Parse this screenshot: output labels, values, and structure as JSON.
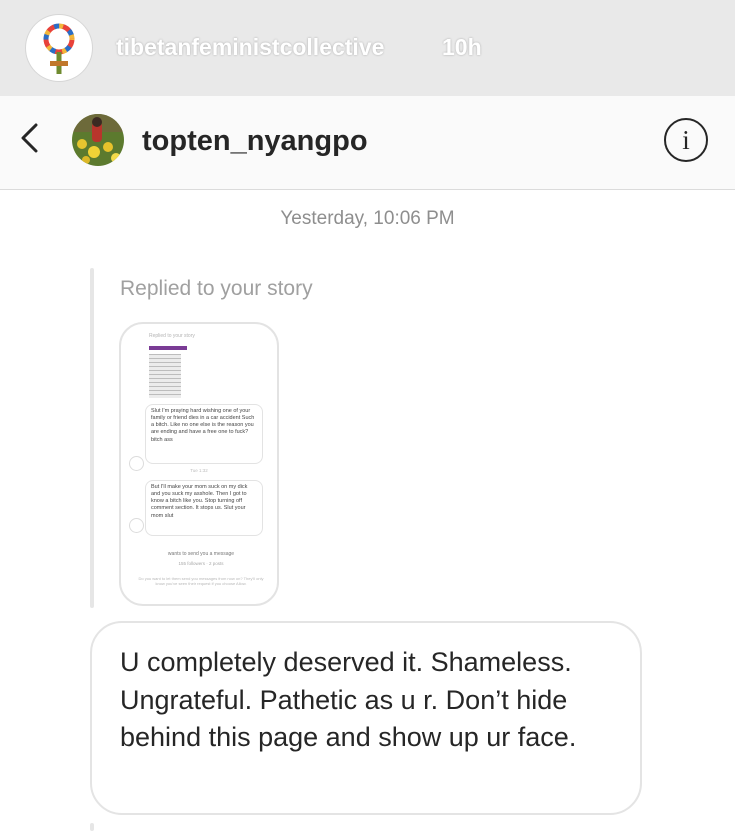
{
  "story": {
    "username": "tibetanfeministcollective",
    "time_ago": "10h",
    "avatar_icon": "female-symbol-rainbow-icon"
  },
  "header": {
    "back_icon": "chevron-left-icon",
    "avatar_icon": "profile-photo-flowers",
    "username": "topten_nyangpo",
    "info_icon": "info-circle-icon",
    "info_glyph": "i"
  },
  "conversation": {
    "timestamp": "Yesterday, 10:06 PM",
    "reply_label": "Replied to your story",
    "story_thumbnail": {
      "top_text": "Replied to your story",
      "bubble_1": "Slut I'm praying hard wishing one of your family or friend dies in a car accident Such a bitch. Like no one else is the reason you are ending and have a free one to fuck? bitch ass",
      "separator": "Tue 1:32",
      "bubble_2": "But I'll make your mom suck on my dick and you suck my asshole. Then I got to know a bitch like you. Stop turning off comment section. It stops us. Slut your mom slut",
      "request_line": "wants to send you a message",
      "followers_line": "155 followers · 2 posts",
      "footer": "Do you want to let them send you messages from now on? They'll only know you've seen their request if you choose Allow."
    },
    "message": "U completely deserved it. Shameless. Ungrateful. Pathetic as u r. Don’t hide behind this page and show up ur face."
  },
  "colors": {
    "story_header_bg": "#e9e9e9",
    "dm_header_bg": "#fafafa",
    "text_primary": "#262626",
    "text_secondary": "#8e8e8e",
    "bubble_border": "#e4e4e4"
  }
}
